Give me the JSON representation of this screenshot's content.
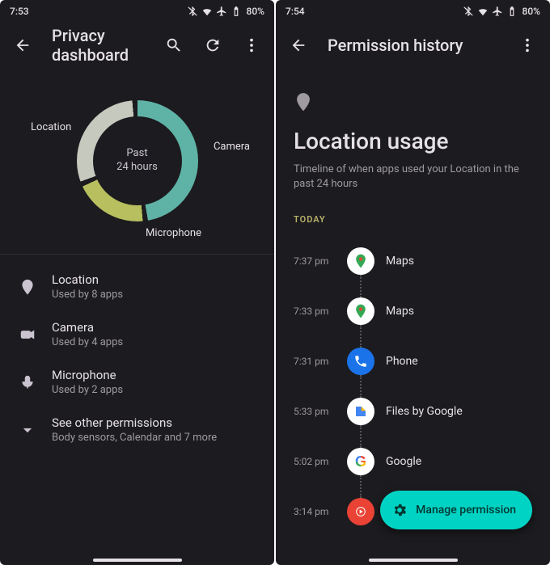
{
  "colors": {
    "location": "#5fb3a6",
    "camera": "#c6c9bd",
    "microphone": "#b7bf5e",
    "accent": "#00d3c4"
  },
  "left": {
    "status": {
      "time": "7:53",
      "battery": "80%"
    },
    "appbar": {
      "title": "Privacy dashboard"
    },
    "donut": {
      "center_line1": "Past",
      "center_line2": "24 hours",
      "labels": {
        "location": "Location",
        "camera": "Camera",
        "microphone": "Microphone"
      }
    },
    "permissions": [
      {
        "icon": "location",
        "title": "Location",
        "sub": "Used by 8 apps"
      },
      {
        "icon": "camera",
        "title": "Camera",
        "sub": "Used by 4 apps"
      },
      {
        "icon": "mic",
        "title": "Microphone",
        "sub": "Used by 2 apps"
      }
    ],
    "see_other": {
      "title": "See other permissions",
      "sub": "Body sensors, Calendar and 7 more"
    }
  },
  "right": {
    "status": {
      "time": "7:54",
      "battery": "80%"
    },
    "appbar": {
      "title": "Permission history"
    },
    "header": {
      "title": "Location usage",
      "sub": "Timeline of when apps used your Location in the past 24 hours"
    },
    "today_label": "TODAY",
    "timeline": [
      {
        "time": "7:37 pm",
        "app": "Maps",
        "icon": "maps"
      },
      {
        "time": "7:33 pm",
        "app": "Maps",
        "icon": "maps"
      },
      {
        "time": "7:31 pm",
        "app": "Phone",
        "icon": "phone"
      },
      {
        "time": "5:33 pm",
        "app": "Files by Google",
        "icon": "files"
      },
      {
        "time": "5:02 pm",
        "app": "Google",
        "icon": "google"
      },
      {
        "time": "3:14 pm",
        "app": "",
        "icon": "ytmusic"
      }
    ],
    "fab": {
      "label": "Manage permission"
    }
  },
  "chart_data": {
    "type": "pie",
    "title": "Past 24 hours",
    "series": [
      {
        "name": "Location",
        "value": 8,
        "color": "#5fb3a6"
      },
      {
        "name": "Camera",
        "value": 4,
        "color": "#c6c9bd"
      },
      {
        "name": "Microphone",
        "value": 2,
        "color": "#b7bf5e"
      }
    ]
  }
}
